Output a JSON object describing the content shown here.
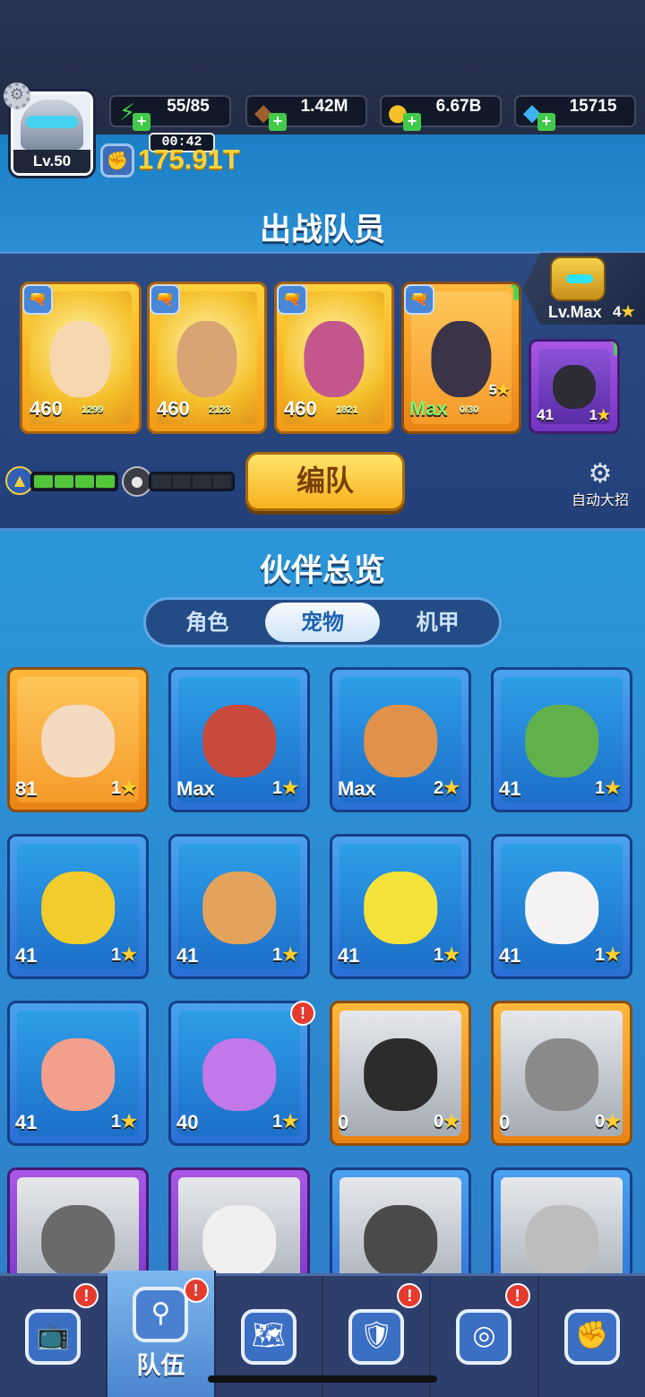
{
  "player": {
    "level": "Lv.50"
  },
  "resources": [
    {
      "name": "stamina",
      "icon": "lightning-icon",
      "value": "55/85"
    },
    {
      "name": "exp",
      "icon": "exp-bag-icon",
      "value": "1.42M"
    },
    {
      "name": "coins",
      "icon": "coin-icon",
      "value": "6.67B"
    },
    {
      "name": "gems",
      "icon": "gem-icon",
      "value": "15715"
    }
  ],
  "timer": "00:42",
  "power": "175.91T",
  "team": {
    "title": "出战队员",
    "mech": {
      "level": "Lv.Max",
      "stars": "4"
    },
    "members": [
      {
        "level": "460",
        "sub": "1299",
        "rarity": "gold"
      },
      {
        "level": "460",
        "sub": "2123",
        "rarity": "gold"
      },
      {
        "level": "460",
        "sub": "1821",
        "rarity": "gold"
      },
      {
        "level": "Max",
        "sub": "0/30",
        "stars": "5",
        "rarity": "orange"
      }
    ],
    "pet": {
      "level": "41",
      "stars": "1"
    },
    "formation_button": "编队",
    "auto_skill": "自动大招"
  },
  "overview": {
    "title": "伙伴总览",
    "tabs": [
      "角色",
      "宠物",
      "机甲"
    ],
    "active_tab": "宠物",
    "pets": [
      {
        "level": "81",
        "stars": "1",
        "rarity": "orange"
      },
      {
        "level": "Max",
        "stars": "1",
        "rarity": "blue"
      },
      {
        "level": "Max",
        "stars": "2",
        "rarity": "blue"
      },
      {
        "level": "41",
        "stars": "1",
        "rarity": "blue"
      },
      {
        "level": "41",
        "stars": "1",
        "rarity": "blue"
      },
      {
        "level": "41",
        "stars": "1",
        "rarity": "blue"
      },
      {
        "level": "41",
        "stars": "1",
        "rarity": "blue"
      },
      {
        "level": "41",
        "stars": "1",
        "rarity": "blue"
      },
      {
        "level": "41",
        "stars": "1",
        "rarity": "blue"
      },
      {
        "level": "40",
        "stars": "1",
        "rarity": "blue"
      },
      {
        "level": "0",
        "stars": "0",
        "rarity": "orange"
      },
      {
        "level": "0",
        "stars": "0",
        "rarity": "orange"
      },
      {
        "level": "",
        "stars": "",
        "rarity": "purple"
      },
      {
        "level": "",
        "stars": "",
        "rarity": "purple"
      },
      {
        "level": "",
        "stars": "",
        "rarity": "blue"
      },
      {
        "level": "",
        "stars": "",
        "rarity": "blue"
      }
    ]
  },
  "nav": [
    {
      "icon": "tv-icon",
      "label": "",
      "badge": "!"
    },
    {
      "icon": "keyhole-icon",
      "label": "队伍",
      "badge": "!"
    },
    {
      "icon": "map-icon",
      "label": "",
      "badge": ""
    },
    {
      "icon": "shield-icon",
      "label": "",
      "badge": "!"
    },
    {
      "icon": "target-icon",
      "label": "",
      "badge": "!"
    },
    {
      "icon": "guild-icon",
      "label": "",
      "badge": ""
    }
  ]
}
